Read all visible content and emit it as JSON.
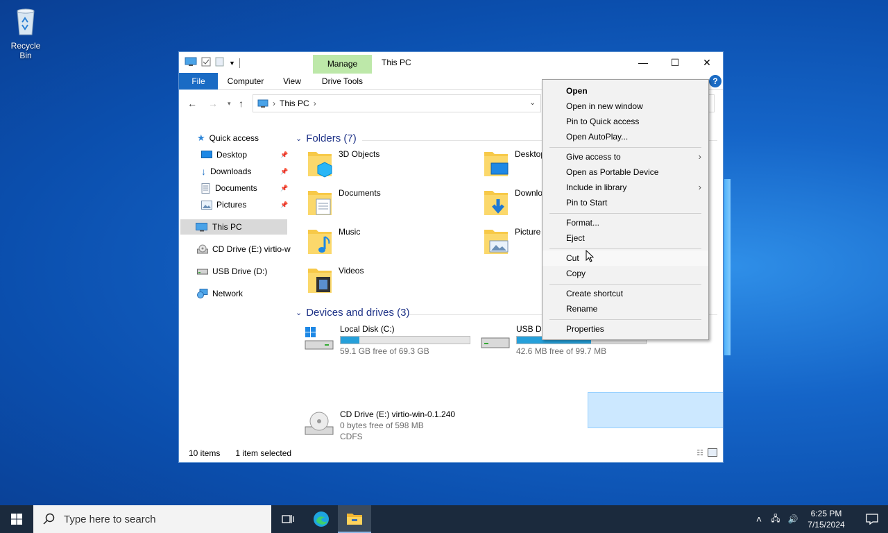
{
  "desktop": {
    "recycle_bin_label": "Recycle Bin"
  },
  "window": {
    "contextual_tab": "Manage",
    "contextual_subtab": "Drive Tools",
    "title": "This PC",
    "ribbon_tabs": [
      "File",
      "Computer",
      "View"
    ],
    "address_path": "This PC"
  },
  "sidebar": {
    "quick_access": "Quick access",
    "items": [
      {
        "label": "Desktop"
      },
      {
        "label": "Downloads"
      },
      {
        "label": "Documents"
      },
      {
        "label": "Pictures"
      },
      {
        "label": "This PC"
      },
      {
        "label": "CD Drive (E:) virtio-w"
      },
      {
        "label": "USB Drive (D:)"
      },
      {
        "label": "Network"
      }
    ]
  },
  "content": {
    "folders_header": "Folders (7)",
    "folders": [
      {
        "name": "3D Objects"
      },
      {
        "name": "Desktop"
      },
      {
        "name": "Documents"
      },
      {
        "name": "Downlo"
      },
      {
        "name": "Music"
      },
      {
        "name": "Picture"
      },
      {
        "name": "Videos"
      }
    ],
    "devices_header": "Devices and drives (3)",
    "drives": [
      {
        "name": "Local Disk (C:)",
        "free": "59.1 GB free of 69.3 GB",
        "used_fraction": 0.147
      },
      {
        "name": "USB Dri",
        "free": "42.6 MB free of 99.7 MB",
        "used_fraction": 0.573
      },
      {
        "name": "CD Drive (E:) virtio-win-0.1.240",
        "free": "0 bytes free of 598 MB",
        "fs": "CDFS"
      }
    ]
  },
  "status": {
    "items": "10 items",
    "selected": "1 item selected"
  },
  "context_menu": {
    "items": [
      {
        "label": "Open"
      },
      {
        "label": "Open in new window"
      },
      {
        "label": "Pin to Quick access"
      },
      {
        "label": "Open AutoPlay..."
      },
      {
        "label": "Give access to"
      },
      {
        "label": "Open as Portable Device"
      },
      {
        "label": "Include in library"
      },
      {
        "label": "Pin to Start"
      },
      {
        "label": "Format..."
      },
      {
        "label": "Eject"
      },
      {
        "label": "Cut"
      },
      {
        "label": "Copy"
      },
      {
        "label": "Create shortcut"
      },
      {
        "label": "Rename"
      },
      {
        "label": "Properties"
      }
    ]
  },
  "taskbar": {
    "search_placeholder": "Type here to search",
    "time": "6:25 PM",
    "date": "7/15/2024"
  },
  "colors": {
    "accent": "#1a6bc4",
    "manage_tab": "#bde8a9",
    "selection": "#cce8ff",
    "drive_bar": "#26a0da"
  }
}
